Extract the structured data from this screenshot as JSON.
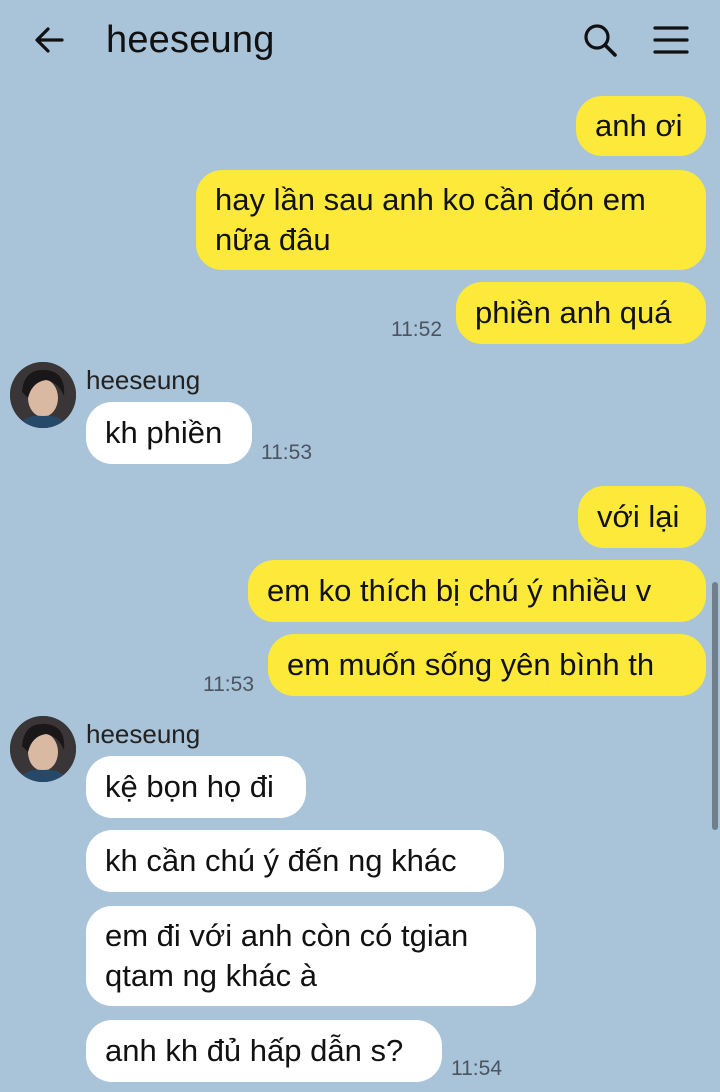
{
  "header": {
    "title": "heeseung",
    "back_icon": "arrow-left-icon",
    "search_icon": "search-icon",
    "menu_icon": "hamburger-menu-icon"
  },
  "colors": {
    "background": "#a9c3d8",
    "my_bubble": "#fde93a",
    "their_bubble": "#ffffff"
  },
  "messages": {
    "m1": "anh ơi",
    "m2": "hay lần sau anh ko cần đón em nữa đâu",
    "m3": "phiền anh quá",
    "t1": "11:52",
    "s1": "heeseung",
    "r1": "kh phiền",
    "t2": "11:53",
    "m4": "với lại",
    "m5": "em ko thích bị chú ý nhiều v",
    "m6": "em muốn sống yên bình th",
    "t3": "11:53",
    "s2": "heeseung",
    "r2": "kệ bọn họ đi",
    "r3": "kh cần chú ý đến ng khác",
    "r4": "em đi với anh còn có tgian qtam ng khác à",
    "r5": "anh kh đủ hấp dẫn s?",
    "t4": "11:54"
  }
}
